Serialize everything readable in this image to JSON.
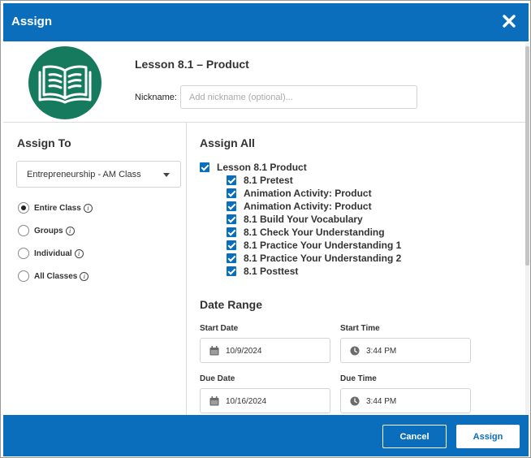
{
  "dialog": {
    "title": "Assign",
    "close_icon": "close-x-icon"
  },
  "lesson": {
    "title": "Lesson 8.1 – Product",
    "icon": "open-book-icon",
    "icon_color": "#157a5e"
  },
  "nickname": {
    "label": "Nickname:",
    "placeholder": "Add nickname (optional)...",
    "value": ""
  },
  "assign_to": {
    "heading": "Assign To",
    "class_select": {
      "value": "Entrepreneurship - AM Class"
    },
    "options": [
      {
        "label": "Entire Class",
        "selected": true
      },
      {
        "label": "Groups",
        "selected": false
      },
      {
        "label": "Individual",
        "selected": false
      },
      {
        "label": "All Classes",
        "selected": false
      }
    ],
    "info_icon": "i"
  },
  "assign_all": {
    "heading": "Assign All",
    "parent": {
      "label": "Lesson 8.1 Product",
      "checked": true
    },
    "items": [
      {
        "label": "8.1 Pretest",
        "checked": true
      },
      {
        "label": "Animation Activity: Product",
        "checked": true
      },
      {
        "label": "Animation Activity: Product",
        "checked": true
      },
      {
        "label": "8.1 Build Your Vocabulary",
        "checked": true
      },
      {
        "label": "8.1 Check Your Understanding",
        "checked": true
      },
      {
        "label": "8.1 Practice Your Understanding 1",
        "checked": true
      },
      {
        "label": "8.1 Practice Your Understanding 2",
        "checked": true
      },
      {
        "label": "8.1 Posttest",
        "checked": true
      }
    ]
  },
  "date_range": {
    "heading": "Date Range",
    "start_date": {
      "label": "Start Date",
      "value": "10/9/2024",
      "icon": "calendar-icon"
    },
    "start_time": {
      "label": "Start Time",
      "value": "3:44 PM",
      "icon": "clock-icon"
    },
    "due_date": {
      "label": "Due Date",
      "value": "10/16/2024",
      "icon": "calendar-icon"
    },
    "due_time": {
      "label": "Due Time",
      "value": "3:44 PM",
      "icon": "clock-icon"
    }
  },
  "footer": {
    "cancel_label": "Cancel",
    "assign_label": "Assign"
  },
  "colors": {
    "primary": "#0a6ebd",
    "lesson_icon_bg": "#157a5e",
    "checkbox": "#0a6ebd"
  }
}
